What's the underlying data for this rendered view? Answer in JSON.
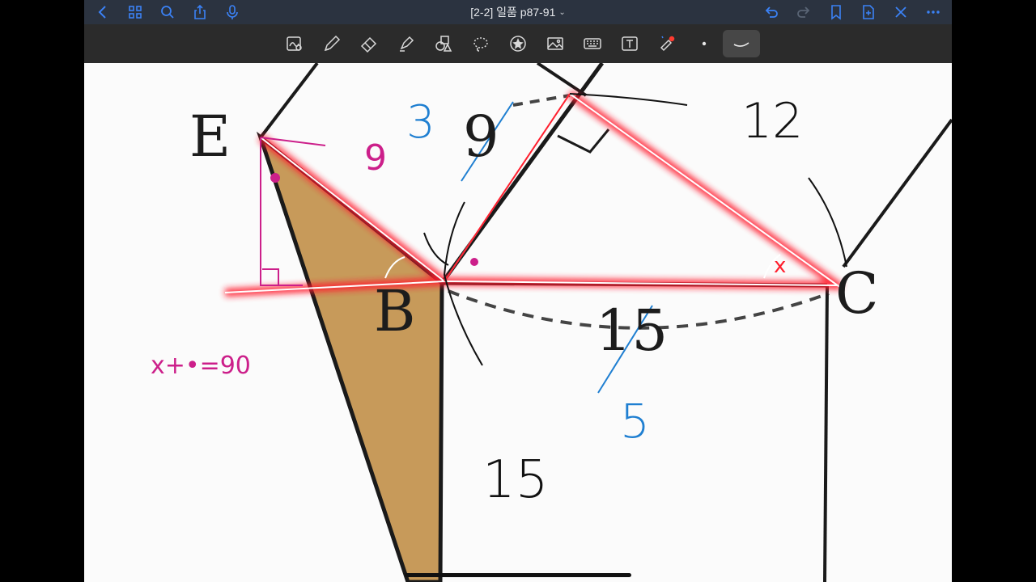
{
  "window": {
    "title": "[2-2] 일품 p87-91"
  },
  "topbar": {
    "left_icons": [
      "back-icon",
      "grid-icon",
      "search-icon",
      "share-icon",
      "microphone-icon"
    ],
    "right_icons": [
      "undo-icon",
      "redo-icon",
      "bookmark-icon",
      "add-page-icon",
      "close-icon",
      "more-icon"
    ]
  },
  "toolbar": {
    "tools": [
      "lasso-ink-icon",
      "pen-icon",
      "eraser-icon",
      "highlighter-icon",
      "shapes-icon",
      "lasso-icon",
      "sticker-icon",
      "image-icon",
      "keyboard-icon",
      "text-icon",
      "laser-pointer-icon",
      "pen-size-dot-icon",
      "stroke-style-icon"
    ],
    "active_tool": "stroke-style-icon"
  },
  "figure": {
    "vertex_labels": {
      "E": "E",
      "B": "B",
      "C": "C"
    },
    "printed_lengths": {
      "top": "9",
      "bottom": "15"
    }
  },
  "annotations": {
    "blue": {
      "top": "3",
      "bottom": "5"
    },
    "black": {
      "top_right": "12",
      "bottom": "15"
    },
    "magenta": {
      "near_E": "9",
      "equation": "x+•=90"
    },
    "angle_mark": "x"
  },
  "colors": {
    "topbar_bg": "#2b3340",
    "toolbar_bg": "#2b2b2b",
    "accent_blue": "#3b82f6",
    "magenta": "#cc1f8a",
    "red_highlight": "#ff1f2e",
    "triangle_fill": "#c79a5a",
    "blue_ink": "#1f7fd1"
  }
}
